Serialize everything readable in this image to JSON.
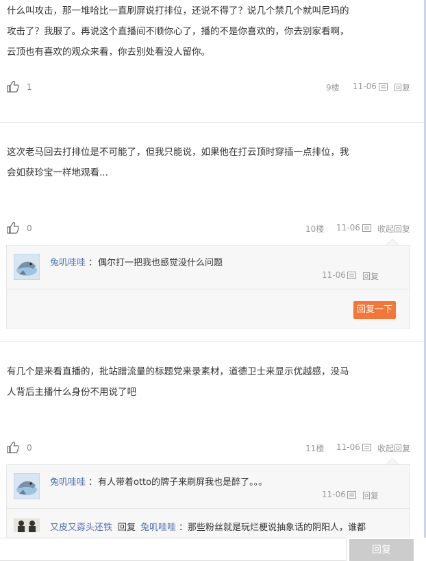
{
  "posts": [
    {
      "text_lines": [
        "什么叫攻击，那一堆哈比一直刷屏说打排位，还说不得了？说几个禁几个就叫尼玛的",
        "攻击了？我服了。再说这个直播间不顺你心了，播的不是你喜欢的，你去别家看啊，",
        "云顶也有喜欢的观众来看，你去别处看没人留你。"
      ],
      "likes": "1",
      "floor": "9楼",
      "date": "11-06",
      "reply_label": "回复"
    },
    {
      "text_lines": [
        "这次老马回去打排位是不可能了，但我只能说，如果他在打云顶时穿插一点排位，我",
        "会如获珍宝一样地观看..."
      ],
      "likes": "0",
      "floor": "10楼",
      "date": "11-06",
      "reply_label": "收起回复",
      "sub_replies": [
        {
          "user": "兔叽哇哇",
          "sep": "：",
          "text": "偶尔打一把我也感觉没什么问题",
          "date": "11-06",
          "reply_label": "回复"
        }
      ],
      "reply_button": "回复一下"
    },
    {
      "text_lines": [
        "有几个是来看直播的，批站蹭流量的标题党来录素材，道德卫士来显示优越感，没马",
        "人背后主播什么身份不用说了吧"
      ],
      "likes": "0",
      "floor": "11楼",
      "date": "11-06",
      "reply_label": "收起回复",
      "sub_replies": [
        {
          "user": "兔叽哇哇",
          "sep": "：",
          "text": "有人带着otto的牌子来刷屏我也是醉了。。。",
          "date": "11-06",
          "reply_label": "回复"
        },
        {
          "user": "又皮又孬头还铁",
          "reply_word": "回复",
          "target": "兔叽哇哇",
          "sep": "：",
          "text": "那些粉丝就是玩烂梗说抽象话的阴阳人，谁都"
        }
      ]
    }
  ],
  "bottom": {
    "button": "回复",
    "placeholder": ""
  }
}
